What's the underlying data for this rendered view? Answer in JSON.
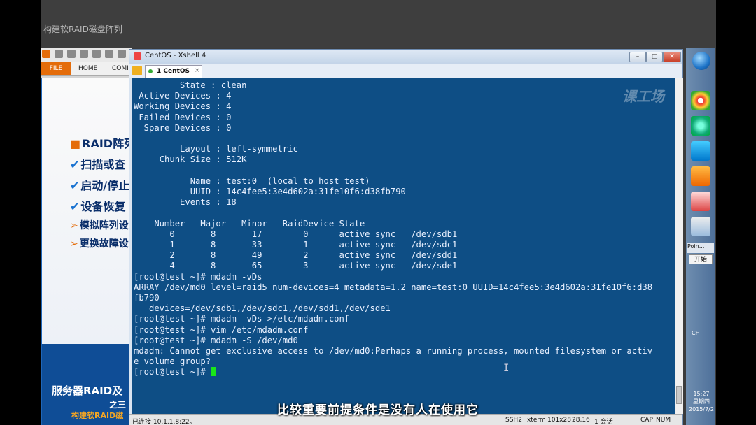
{
  "video": {
    "title": "构建软RAID磁盘阵列",
    "subtitle": "比较重要前提条件是没有人在使用它"
  },
  "ppt": {
    "tabs": [
      "FILE",
      "HOME",
      "COMI"
    ],
    "slide_lines": [
      {
        "bullet": "■",
        "text": "RAID阵列"
      },
      {
        "bullet": "✔",
        "text": "扫描或查"
      },
      {
        "bullet": "✔",
        "text": "启动/停止"
      },
      {
        "bullet": "✔",
        "text": "设备恢复"
      },
      {
        "bullet": "➢",
        "text": "模拟阵列设"
      },
      {
        "bullet": "➢",
        "text": "更换故障设"
      }
    ],
    "bottom_title": "服务器RAID及",
    "bottom_sub": "之三",
    "bottom_sub2": "构建软RAID磁"
  },
  "xshell": {
    "window_title": "CentOS - Xshell 4",
    "tab_label": "1 CentOS",
    "tab_close": "×",
    "win_min": "–",
    "win_max": "□",
    "win_close": "✕",
    "watermark": "课工场",
    "terminal_lines": [
      "         State : clean",
      " Active Devices : 4",
      "Working Devices : 4",
      " Failed Devices : 0",
      "  Spare Devices : 0",
      "",
      "         Layout : left-symmetric",
      "     Chunk Size : 512K",
      "",
      "           Name : test:0  (local to host test)",
      "           UUID : 14c4fee5:3e4d602a:31fe10f6:d38fb790",
      "         Events : 18",
      "",
      "    Number   Major   Minor   RaidDevice State",
      "       0       8       17        0      active sync   /dev/sdb1",
      "       1       8       33        1      active sync   /dev/sdc1",
      "       2       8       49        2      active sync   /dev/sdd1",
      "       4       8       65        3      active sync   /dev/sde1",
      "[root@test ~]# mdadm -vDs",
      "ARRAY /dev/md0 level=raid5 num-devices=4 metadata=1.2 name=test:0 UUID=14c4fee5:3e4d602a:31fe10f6:d38",
      "fb790",
      "   devices=/dev/sdb1,/dev/sdc1,/dev/sdd1,/dev/sde1",
      "[root@test ~]# mdadm -vDs >/etc/mdadm.conf",
      "[root@test ~]# vim /etc/mdadm.conf",
      "[root@test ~]# mdadm -S /dev/md0",
      "mdadm: Cannot get exclusive access to /dev/md0:Perhaps a running process, mounted filesystem or activ",
      "e volume group?"
    ],
    "prompt": "[root@test ~]# ",
    "ibeam": "I",
    "status": {
      "connection": "已连接 10.1.1.8:22。",
      "protocol": "SSH2",
      "term": "xterm",
      "size": "101x28",
      "cursor_pos": "28,16",
      "sessions": "1 会话",
      "caps": "CAP",
      "num": "NUM"
    }
  },
  "taskbar": {
    "tray_label": "Poin...",
    "start_label": "开始",
    "lang": "CH",
    "time": "15:27",
    "weekday": "星期四",
    "date": "2015/7/2"
  },
  "colors": {
    "terminal_bg": "#0e4e85",
    "terminal_fg": "#e8f0ff",
    "cursor": "#19e619",
    "ppt_accent": "#e46c0a"
  }
}
